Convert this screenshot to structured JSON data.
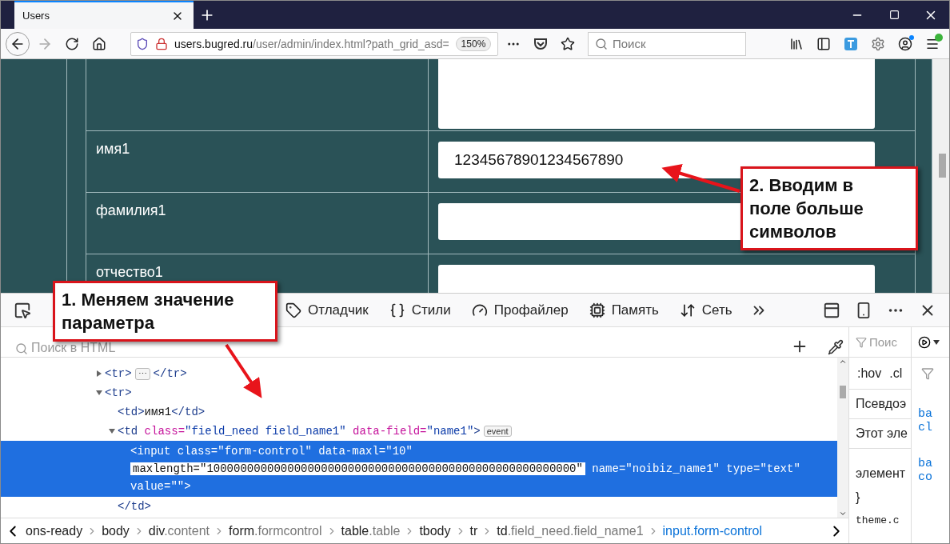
{
  "browser": {
    "tab_title": "Users",
    "url_host": "users.bugred.ru",
    "url_path": "/user/admin/index.html?path_grid_asd=",
    "zoom": "150%",
    "search_placeholder": "Поиск"
  },
  "page": {
    "rows": [
      {
        "kind": "textarea"
      },
      {
        "kind": "input",
        "label": "имя1",
        "value": "12345678901234567890"
      },
      {
        "kind": "input",
        "label": "фамилия1"
      },
      {
        "kind": "input",
        "label": "отчество1"
      }
    ]
  },
  "callouts": [
    {
      "text": "1. Меняем значение параметра"
    },
    {
      "text": "2. Вводим в поле больше символов"
    }
  ],
  "devtools": {
    "tools": [
      {
        "label": "Отладчик",
        "kind": "debugger"
      },
      {
        "label": "Стили",
        "kind": "style"
      },
      {
        "label": "Профайлер",
        "kind": "performance"
      },
      {
        "label": "Память",
        "kind": "memory"
      },
      {
        "label": "Сеть",
        "kind": "network"
      }
    ],
    "search_placeholder": "Поиск в HTML",
    "tree": [
      {
        "selected": false,
        "expanded": false,
        "parts": [
          {
            "kind": "tag",
            "text": "<tr>"
          },
          {
            "kind": "badge",
            "text": "⋯"
          },
          {
            "kind": "tag",
            "text": "</tr>"
          }
        ]
      },
      {
        "selected": false,
        "expanded": true,
        "parts": [
          {
            "kind": "tag",
            "text": "<tr>"
          }
        ],
        "children": [
          {
            "selected": false,
            "parts": [
              {
                "kind": "tag",
                "text": "<td>"
              },
              {
                "kind": "text",
                "text": "имя1"
              },
              {
                "kind": "tag",
                "text": "</td>"
              }
            ]
          },
          {
            "selected": false,
            "expanded": true,
            "parts": [
              {
                "kind": "tag",
                "text": "<td"
              },
              {
                "kind": "attr",
                "text": " class="
              },
              {
                "kind": "value",
                "text": "\"field_need field_name1\""
              },
              {
                "kind": "attr",
                "text": " data-field="
              },
              {
                "kind": "value",
                "text": "\"name1\""
              },
              {
                "kind": "tag",
                "text": ">"
              },
              {
                "kind": "badge",
                "text": "event"
              }
            ],
            "closing": [
              {
                "kind": "tag",
                "text": "</td>"
              }
            ],
            "children": [
              {
                "selected": true,
                "lines": [
                  [
                    {
                      "kind": "tag",
                      "text": "<input"
                    },
                    {
                      "kind": "attr",
                      "text": " class="
                    },
                    {
                      "kind": "value",
                      "text": "\"form-control\""
                    },
                    {
                      "kind": "attr",
                      "text": " data-maxl="
                    },
                    {
                      "kind": "value",
                      "text": "\"10\""
                    }
                  ],
                  [
                    {
                      "kind": "edit",
                      "text": "maxlength=\"1000000000000000000000000000000000000000000000000000000\""
                    },
                    {
                      "kind": "attr",
                      "text": " name="
                    },
                    {
                      "kind": "value",
                      "text": "\"noibiz_name1\""
                    },
                    {
                      "kind": "attr",
                      "text": " type="
                    },
                    {
                      "kind": "value",
                      "text": "\"text\""
                    }
                  ],
                  [
                    {
                      "kind": "attr",
                      "text": "value="
                    },
                    {
                      "kind": "value",
                      "text": "\"\""
                    },
                    {
                      "kind": "tag",
                      "text": ">"
                    }
                  ]
                ]
              }
            ]
          }
        ]
      }
    ],
    "breadcrumbs": [
      {
        "tag": "ons-ready",
        "selected": false
      },
      {
        "tag": "body",
        "selected": false
      },
      {
        "tag": "div",
        "cls": ".content",
        "selected": false
      },
      {
        "tag": "form",
        "cls": ".formcontrol",
        "selected": false
      },
      {
        "tag": "table",
        "cls": ".table",
        "selected": false
      },
      {
        "tag": "tbody",
        "selected": false
      },
      {
        "tag": "tr",
        "selected": false
      },
      {
        "tag": "td",
        "cls": ".field_need.field_name1",
        "selected": false
      },
      {
        "tag": "input",
        "cls": ".form-control",
        "selected": true
      }
    ],
    "rules": {
      "search_placeholder": "Поис",
      "pseudo_hov": ":hov",
      "pseudo_cls": ".cl",
      "lines": [
        "Псевдоэ",
        "Этот эле",
        "элемент",
        "}",
        "theme.c"
      ]
    },
    "side_links": [
      "ba",
      "cl",
      "ba",
      "co"
    ]
  }
}
